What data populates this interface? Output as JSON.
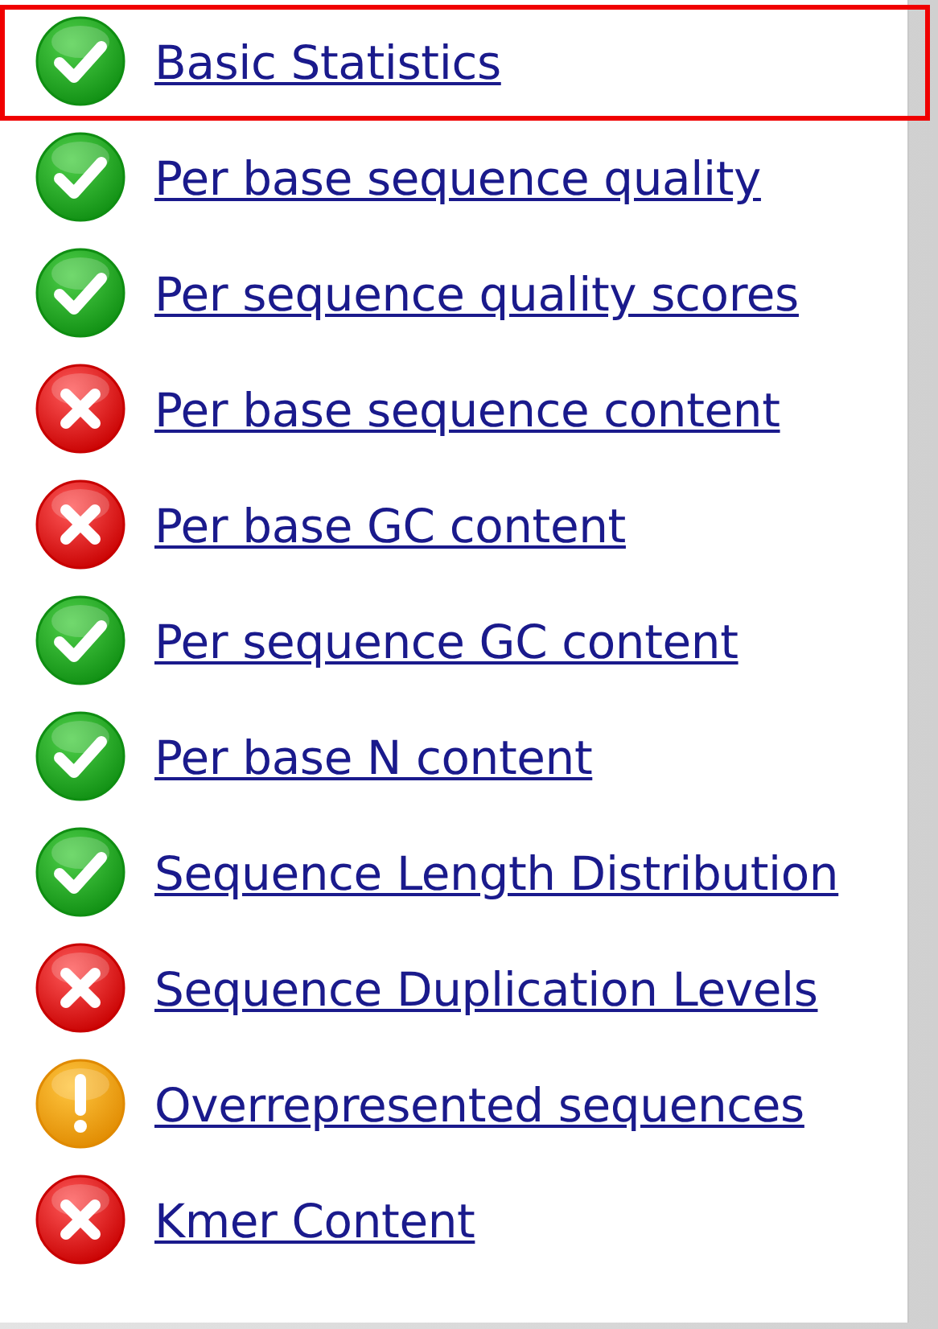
{
  "summary": {
    "items": [
      {
        "label": "Basic Statistics",
        "kind": "pass",
        "highlighted": true
      },
      {
        "label": "Per base sequence quality",
        "kind": "pass",
        "highlighted": false
      },
      {
        "label": "Per sequence quality scores",
        "kind": "pass",
        "highlighted": false
      },
      {
        "label": "Per base sequence content",
        "kind": "fail",
        "highlighted": false
      },
      {
        "label": "Per base GC content",
        "kind": "fail",
        "highlighted": false
      },
      {
        "label": "Per sequence GC content",
        "kind": "pass",
        "highlighted": false
      },
      {
        "label": "Per base N content",
        "kind": "pass",
        "highlighted": false
      },
      {
        "label": "Sequence Length Distribution",
        "kind": "pass",
        "highlighted": false
      },
      {
        "label": "Sequence Duplication Levels",
        "kind": "fail",
        "highlighted": false
      },
      {
        "label": "Overrepresented sequences",
        "kind": "warn",
        "highlighted": false
      },
      {
        "label": "Kmer Content",
        "kind": "fail",
        "highlighted": false
      }
    ]
  }
}
